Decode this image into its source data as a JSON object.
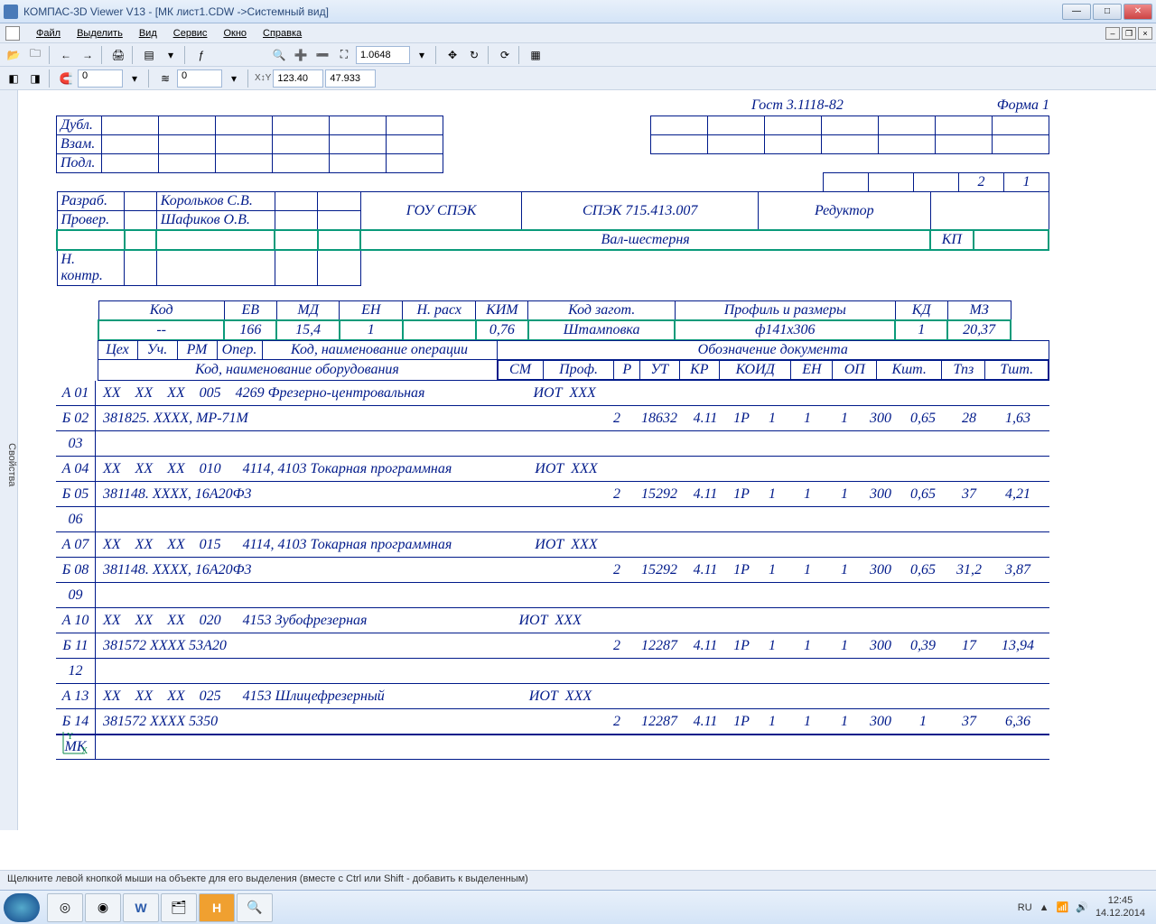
{
  "window": {
    "title": "КОМПАС-3D Viewer V13 - [МК лист1.CDW ->Системный вид]"
  },
  "menu": {
    "items": [
      "Файл",
      "Выделить",
      "Вид",
      "Сервис",
      "Окно",
      "Справка"
    ]
  },
  "toolbar2": {
    "zoom": "1.0648",
    "coord_x": "123.40",
    "coord_y": "47.933",
    "combo1": "0",
    "combo2": "0"
  },
  "sidepanel": {
    "label": "Свойства"
  },
  "doc": {
    "gost": "Гост 3.1118-82",
    "forma": "Форма 1",
    "side_labels": [
      "Дубл.",
      "Взам.",
      "Подл."
    ],
    "page_cur": "2",
    "page_tot": "1",
    "dev_row1_label": "Разраб.",
    "dev_row1_name": "Корольков С.В.",
    "dev_row2_label": "Провер.",
    "dev_row2_name": "Шафиков О.В.",
    "org": "ГОУ СПЭК",
    "code": "СПЭК 715.413.007",
    "product": "Редуктор",
    "part": "Вал-шестерня",
    "nkontr": "Н. контр.",
    "kp": "КП",
    "blank_headers": [
      "Код",
      "ЕВ",
      "МД",
      "ЕН",
      "Н. расх",
      "КИМ",
      "Код загот.",
      "Профиль и размеры",
      "КД",
      "МЗ"
    ],
    "blank_values": [
      "--",
      "166",
      "15,4",
      "1",
      "",
      "0,76",
      "Штамповка",
      "ф141x306",
      "1",
      "20,37"
    ],
    "op_hdr1": [
      "Цех",
      "Уч.",
      "РМ",
      "Опер.",
      "Код, наименование операции",
      "Обозначение документа"
    ],
    "op_hdr2_left": "Код, наименование оборудования",
    "op_hdr2_cols": [
      "СМ",
      "Проф.",
      "Р",
      "УТ",
      "КР",
      "КОИД",
      "ЕН",
      "ОП",
      "Кшт.",
      "Тпз",
      "Тшт."
    ],
    "rows": [
      {
        "lbl": "А 01",
        "txt": "ХХ    ХХ    ХХ    005    4269 Фрезерно-центровальная                              ИОТ  ХХХ"
      },
      {
        "lbl": "Б 02",
        "txt": "381825. ХХХХ, МР-71М",
        "cols": [
          "2",
          "18632",
          "4.11",
          "1Р",
          "1",
          "1",
          "1",
          "300",
          "0,65",
          "28",
          "1,63"
        ]
      },
      {
        "lbl": "03",
        "txt": ""
      },
      {
        "lbl": "А 04",
        "txt": "ХХ    ХХ    ХХ    010      4114, 4103 Токарная программная                       ИОТ  ХХХ"
      },
      {
        "lbl": "Б 05",
        "txt": "381148. ХХХХ, 16А20Ф3",
        "cols": [
          "2",
          "15292",
          "4.11",
          "1Р",
          "1",
          "1",
          "1",
          "300",
          "0,65",
          "37",
          "4,21"
        ]
      },
      {
        "lbl": "06",
        "txt": ""
      },
      {
        "lbl": "А 07",
        "txt": "ХХ    ХХ    ХХ    015      4114, 4103 Токарная программная                       ИОТ  ХХХ"
      },
      {
        "lbl": "Б 08",
        "txt": "381148. ХХХХ, 16А20Ф3",
        "cols": [
          "2",
          "15292",
          "4.11",
          "1Р",
          "1",
          "1",
          "1",
          "300",
          "0,65",
          "31,2",
          "3,87"
        ]
      },
      {
        "lbl": "09",
        "txt": ""
      },
      {
        "lbl": "А 10",
        "txt": "ХХ    ХХ    ХХ    020      4153 Зубофрезерная                                          ИОТ  ХХХ"
      },
      {
        "lbl": "Б 11",
        "txt": "381572 ХХХХ 53А20",
        "cols": [
          "2",
          "12287",
          "4.11",
          "1Р",
          "1",
          "1",
          "1",
          "300",
          "0,39",
          "17",
          "13,94"
        ]
      },
      {
        "lbl": "12",
        "txt": ""
      },
      {
        "lbl": "А 13",
        "txt": "ХХ    ХХ    ХХ    025      4153 Шлицефрезерный                                        ИОТ  ХХХ"
      },
      {
        "lbl": "Б 14",
        "txt": "381572 ХХХХ 5350",
        "cols": [
          "2",
          "12287",
          "4.11",
          "1Р",
          "1",
          "1",
          "1",
          "300",
          "1",
          "37",
          "6,36"
        ]
      }
    ],
    "mk": "МК"
  },
  "statusbar": {
    "text": "Щелкните левой кнопкой мыши на объекте для его выделения (вместе с Ctrl или Shift - добавить к выделенным)"
  },
  "tray": {
    "lang": "RU",
    "time": "12:45",
    "date": "14.12.2014"
  }
}
